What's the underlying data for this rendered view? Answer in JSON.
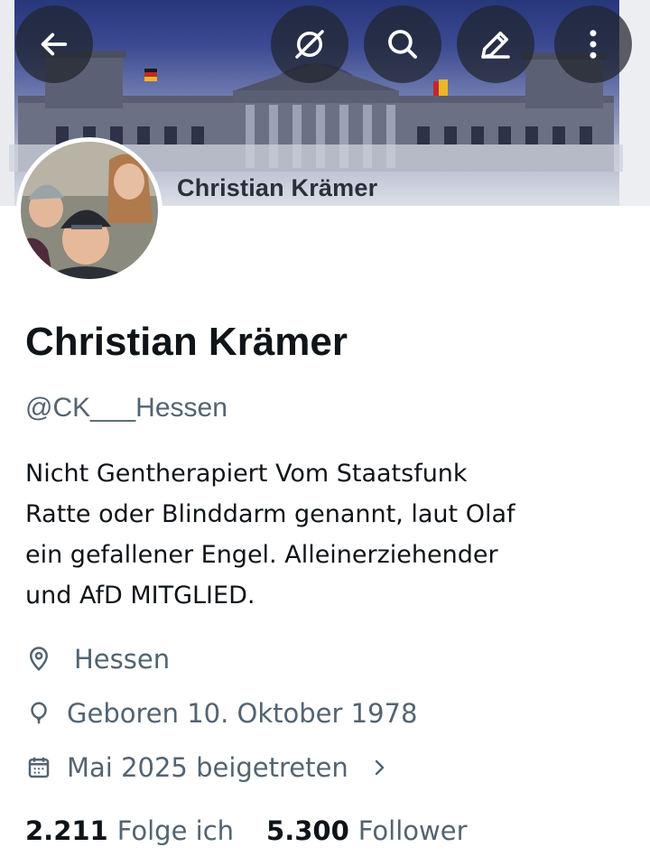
{
  "banner": {
    "caption": "Christian Krämer"
  },
  "top_actions": [
    {
      "name": "back",
      "icon": "arrow-left-icon"
    },
    {
      "name": "grok",
      "icon": "grok-icon"
    },
    {
      "name": "search",
      "icon": "search-icon"
    },
    {
      "name": "edit",
      "icon": "pencil-icon"
    },
    {
      "name": "more",
      "icon": "more-vertical-icon"
    }
  ],
  "profile": {
    "display_name": "Christian Krämer",
    "handle": "@CK___Hessen",
    "bio_lines": [
      "Nicht Gentherapiert Vom Staatsfunk",
      "Ratte oder Blinddarm genannt, laut Olaf",
      "ein gefallener Engel. Alleinerziehender",
      "und AfD MITGLIED."
    ],
    "location": "Hessen",
    "birthday": "Geboren 10. Oktober 1978",
    "joined": "Mai 2025 beigetreten"
  },
  "stats": {
    "following_count": "2.211",
    "following_label": "Folge ich",
    "followers_count": "5.300",
    "followers_label": "Follower"
  },
  "colors": {
    "text_primary": "#0f1419",
    "text_secondary": "#536471",
    "button_overlay": "#20242c"
  }
}
